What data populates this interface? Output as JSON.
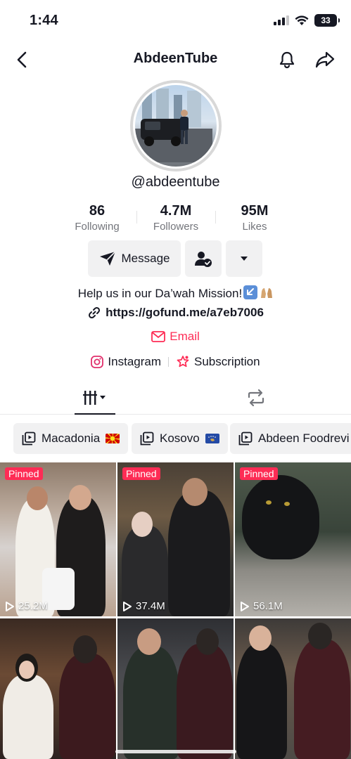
{
  "status": {
    "time": "1:44",
    "battery": "33"
  },
  "header": {
    "title": "AbdeenTube"
  },
  "profile": {
    "handle": "@abdeentube"
  },
  "stats": [
    {
      "value": "86",
      "label": "Following"
    },
    {
      "value": "4.7M",
      "label": "Followers"
    },
    {
      "value": "95M",
      "label": "Likes"
    }
  ],
  "actions": {
    "message_label": "Message"
  },
  "bio": {
    "text": "Help us in our Da’wah Mission!",
    "link": "https://gofund.me/a7eb7006",
    "email_label": "Email",
    "instagram_label": "Instagram",
    "subscription_label": "Subscription"
  },
  "playlists": [
    {
      "label": "Macadonia"
    },
    {
      "label": "Kosovo"
    },
    {
      "label": "Abdeen Foodrevi"
    }
  ],
  "videos": [
    {
      "pinned": "Pinned",
      "views": "25.2M"
    },
    {
      "pinned": "Pinned",
      "views": "37.4M"
    },
    {
      "pinned": "Pinned",
      "views": "56.1M"
    },
    {
      "views": ""
    },
    {
      "views": ""
    },
    {
      "views": ""
    }
  ],
  "colors": {
    "accent": "#fe2c55",
    "text": "#161823",
    "muted": "#73757b",
    "button_bg": "#f1f1f2"
  }
}
